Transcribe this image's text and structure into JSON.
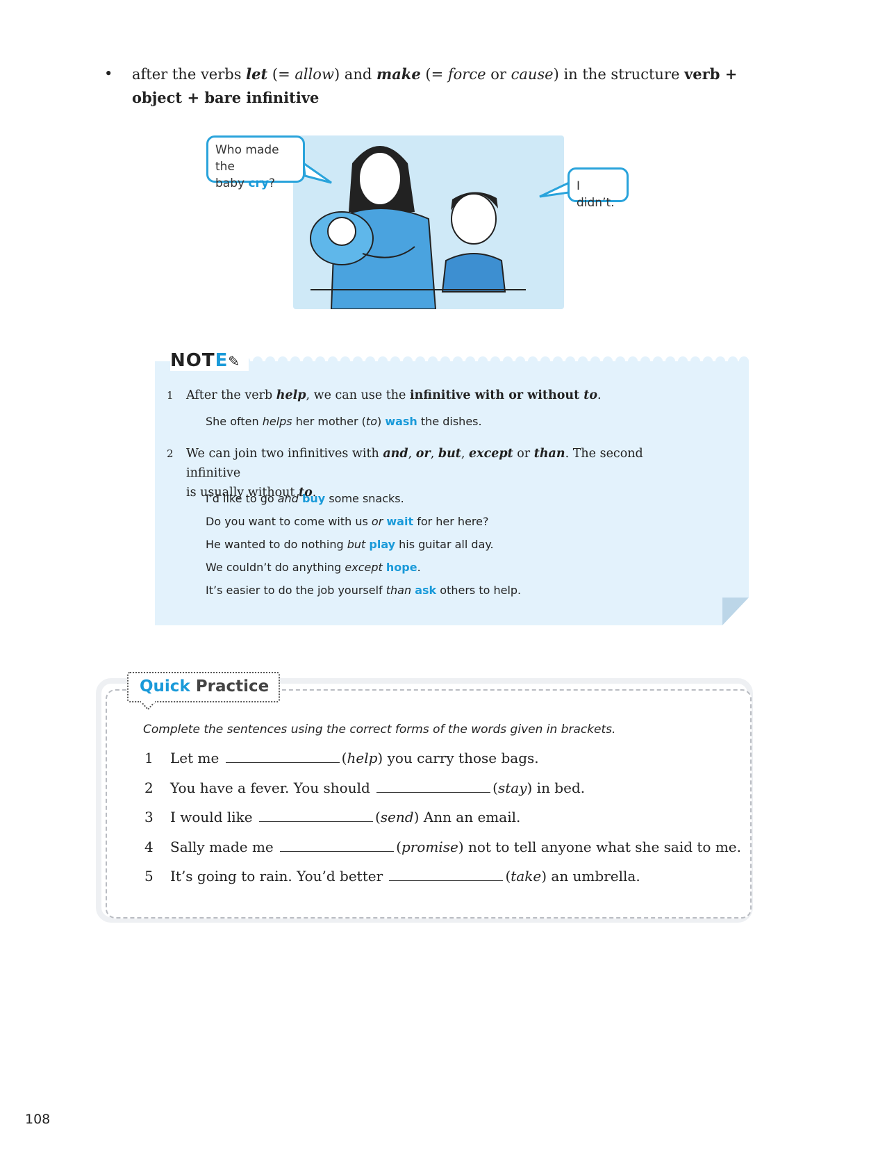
{
  "bullet": {
    "symbol": "•",
    "p1": "after the verbs ",
    "let": "let",
    "p2": " (= ",
    "allow": "allow",
    "p3": ") and ",
    "make": "make",
    "p4": " (= ",
    "force": "force",
    "p5": " or ",
    "cause": "cause",
    "p6": ") in the structure ",
    "structure": "verb + object + bare infinitive"
  },
  "illustration": {
    "bubble_left_line1": "Who made the",
    "bubble_left_line2a": "baby ",
    "bubble_left_cry": "cry",
    "bubble_left_q": "?",
    "bubble_right": "I didn’t."
  },
  "note": {
    "heading": "NOT",
    "heading_e": "E",
    "item1": {
      "num": "1",
      "p1": "After the verb ",
      "help": "help",
      "p2": ", we can use the ",
      "bold": "infinitive with or without ",
      "to": "to",
      "p3": ".",
      "example": {
        "a": "She often ",
        "helps": "helps",
        "b": " her mother (",
        "to": "to",
        "c": ") ",
        "wash": "wash",
        "d": " the dishes."
      }
    },
    "item2": {
      "num": "2",
      "p1": "We can join two infinitives with ",
      "and": "and",
      "c1": ", ",
      "or": "or",
      "c2": ", ",
      "but": "but",
      "c3": ", ",
      "except": "except",
      "p2": " or ",
      "than": "than",
      "p3": ". The second infinitive",
      "p4": "is usually without ",
      "to": "to",
      "p5": ".",
      "examples": [
        {
          "a": "I’d like to go ",
          "i": "and",
          "b": " ",
          "hl": "buy",
          "c": " some snacks."
        },
        {
          "a": "Do you want to come with us ",
          "i": "or",
          "b": " ",
          "hl": "wait",
          "c": " for her here?"
        },
        {
          "a": "He wanted to do nothing ",
          "i": "but",
          "b": " ",
          "hl": "play",
          "c": " his guitar all day."
        },
        {
          "a": "We couldn’t do anything ",
          "i": "except",
          "b": " ",
          "hl": "hope",
          "c": "."
        },
        {
          "a": "It’s easier to do the job yourself ",
          "i": "than",
          "b": " ",
          "hl": "ask",
          "c": " others to help."
        }
      ]
    }
  },
  "quick_practice": {
    "label_quick": "Quick",
    "label_practice": " Practice",
    "instruction": "Complete the sentences using the correct forms of the words given in brackets.",
    "items": [
      {
        "num": "1",
        "before": "Let me",
        "word": "help",
        "after": " you carry those bags."
      },
      {
        "num": "2",
        "before": "You have a fever. You should",
        "word": "stay",
        "after": " in bed."
      },
      {
        "num": "3",
        "before": "I would like",
        "word": "send",
        "after": " Ann an email."
      },
      {
        "num": "4",
        "before": "Sally made me",
        "word": "promise",
        "after": " not to tell anyone what she said to me."
      },
      {
        "num": "5",
        "before": "It’s going to rain. You’d better",
        "word": "take",
        "after": " an umbrella."
      }
    ]
  },
  "page_number": "108",
  "colors": {
    "accent": "#1a9ad9",
    "note_bg": "#e3f2fc",
    "scene_bg": "#cfe9f7"
  }
}
